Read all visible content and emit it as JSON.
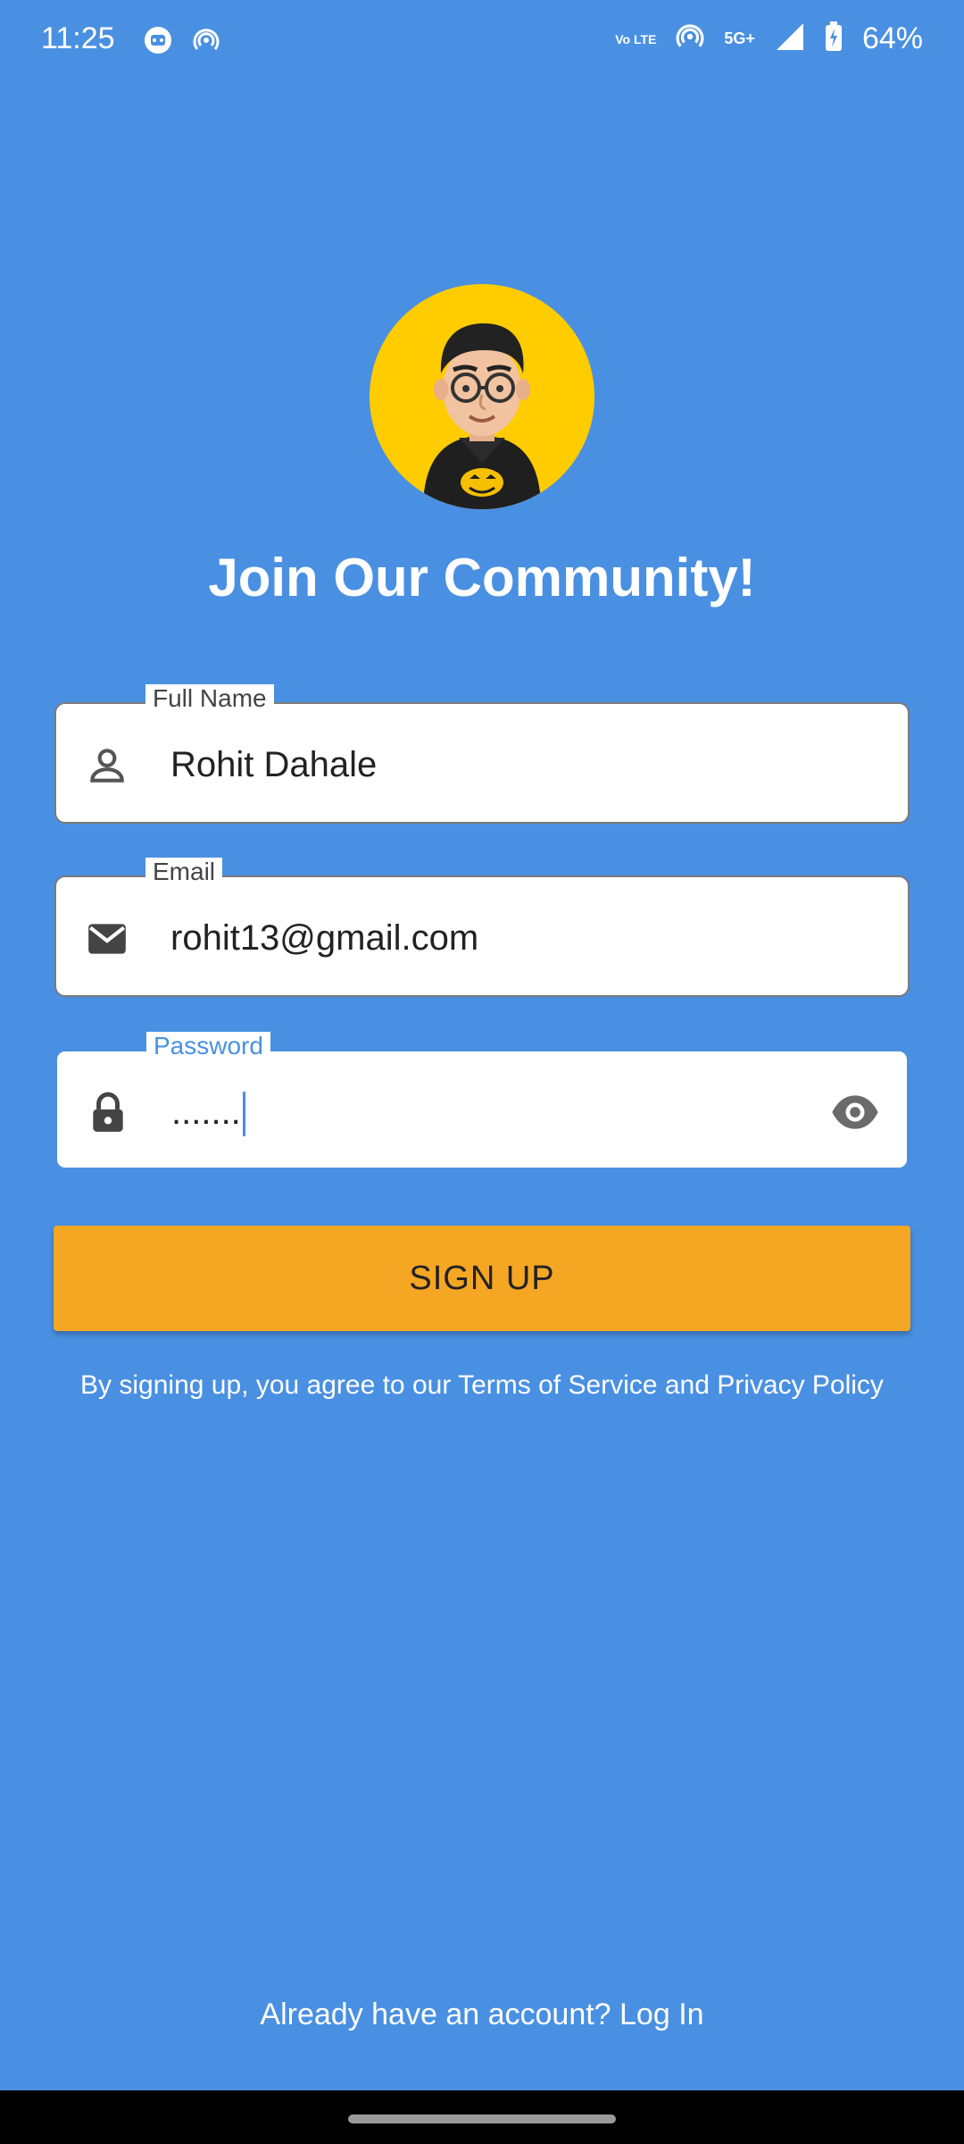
{
  "status_bar": {
    "time": "11:25",
    "network": "5G+",
    "volte": "Vo LTE",
    "battery": "64%"
  },
  "header": {
    "title": "Join Our Community!"
  },
  "form": {
    "full_name": {
      "label": "Full Name",
      "value": "Rohit Dahale",
      "icon": "person-icon"
    },
    "email": {
      "label": "Email",
      "value": "rohit13@gmail.com",
      "icon": "mail-icon"
    },
    "password": {
      "label": "Password",
      "value": ".......",
      "icon": "lock-icon",
      "toggle_icon": "eye-icon"
    }
  },
  "actions": {
    "signup_label": "SIGN UP",
    "terms_text": "By signing up, you agree to our Terms of Service and Privacy Policy",
    "login_text": "Already have an account? Log In"
  },
  "colors": {
    "background": "#4A90E2",
    "button": "#F5A623",
    "avatar_bg": "#FFCC00"
  }
}
